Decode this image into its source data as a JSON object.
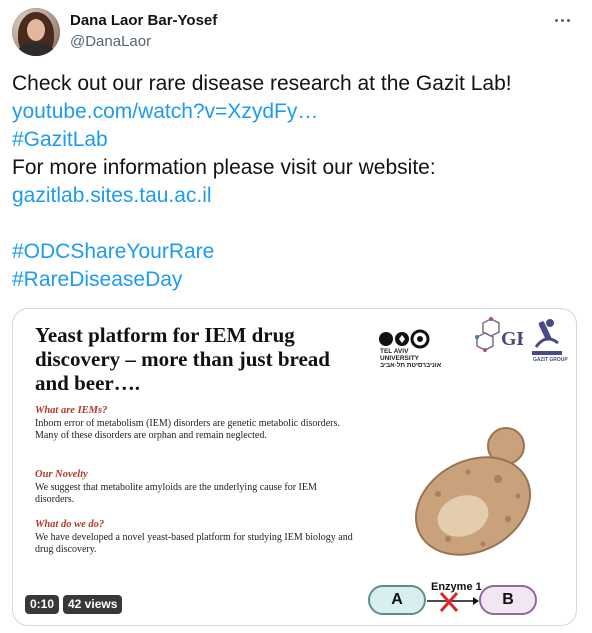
{
  "tweet": {
    "author": {
      "display_name": "Dana Laor Bar-Yosef",
      "handle": "@DanaLaor"
    },
    "text_lines": [
      "Check out our rare disease research at the Gazit Lab!",
      "youtube.com/watch?v=XzydFy…",
      "#GazitLab",
      "For more information please visit our website:",
      "gazitlab.sites.tau.ac.il",
      "",
      "#ODCShareYourRare",
      "#RareDiseaseDay"
    ],
    "link_color": "#1d9bf0"
  },
  "video": {
    "slide": {
      "title": "Yeast platform for IEM drug discovery – more than just bread and beer….",
      "logo_text": "TEL AVIV UNIVERSITY אוניברסיטת תל-אביב",
      "sections": [
        {
          "heading": "What are IEMs?",
          "body": "Inborn error of metabolism (IEM) disorders are genetic metabolic disorders. Many of these disorders are orphan and remain neglected."
        },
        {
          "heading": "Our Novelty",
          "body": "We suggest that metabolite amyloids are the underlying cause for IEM disorders."
        },
        {
          "heading": "What do we do?",
          "body": "We have developed a novel yeast-based platform for studying IEM biology and drug discovery."
        }
      ],
      "diagram": {
        "node_a": "A",
        "enzyme": "Enzyme 1",
        "node_b": "B"
      },
      "heading_color": "#b0392a"
    },
    "duration": "0:10",
    "views": "42 views"
  }
}
